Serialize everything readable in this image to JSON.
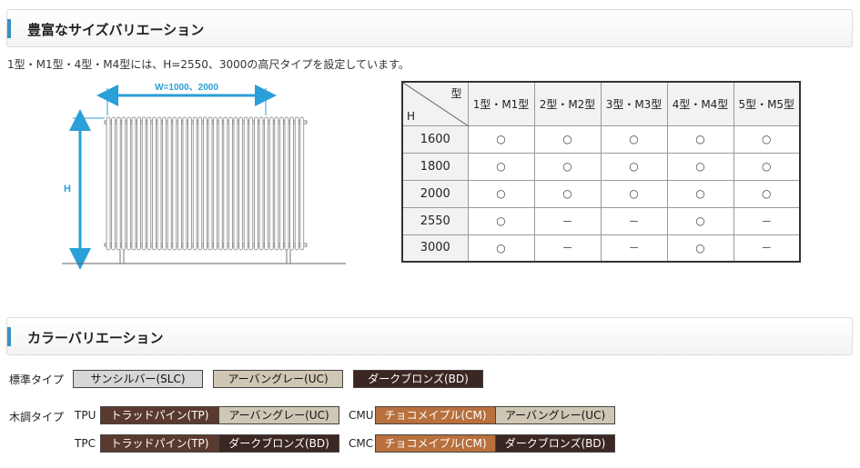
{
  "section1": {
    "title": "豊富なサイズバリエーション"
  },
  "description": "1型・M1型・4型・M4型には、H=2550、3000の高尺タイプを設定しています。",
  "diagram": {
    "width_label": "W=1000、2000",
    "height_label": "H"
  },
  "size_table": {
    "corner_top": "型",
    "corner_bottom": "H",
    "columns": [
      "1型・M1型",
      "2型・M2型",
      "3型・M3型",
      "4型・M4型",
      "5型・M5型"
    ],
    "rows": [
      {
        "h": "1600",
        "values": [
          "○",
          "○",
          "○",
          "○",
          "○"
        ]
      },
      {
        "h": "1800",
        "values": [
          "○",
          "○",
          "○",
          "○",
          "○"
        ]
      },
      {
        "h": "2000",
        "values": [
          "○",
          "○",
          "○",
          "○",
          "○"
        ]
      },
      {
        "h": "2550",
        "values": [
          "○",
          "－",
          "－",
          "○",
          "－"
        ]
      },
      {
        "h": "3000",
        "values": [
          "○",
          "－",
          "－",
          "○",
          "－"
        ]
      }
    ]
  },
  "section2": {
    "title": "カラーバリエーション"
  },
  "colors": {
    "standard_label": "標準タイプ",
    "standard": [
      "サンシルバー(SLC)",
      "アーバングレー(UC)",
      "ダークブロンズ(BD)"
    ],
    "wood_label": "木調タイプ",
    "tpu": {
      "code": "TPU",
      "left": "トラッドパイン(TP)",
      "right": "アーバングレー(UC)"
    },
    "cmu": {
      "code": "CMU",
      "left": "チョコメイプル(CM)",
      "right": "アーバングレー(UC)"
    },
    "tpc": {
      "code": "TPC",
      "left": "トラッドパイン(TP)",
      "right": "ダークブロンズ(BD)"
    },
    "cmc": {
      "code": "CMC",
      "left": "チョコメイプル(CM)",
      "right": "ダークブロンズ(BD)"
    }
  },
  "swatch_colors": {
    "SLC": "#d7d7d7",
    "UC": "#cfc6b4",
    "BD": "#3b2722",
    "TP": "#5a3a2e",
    "CM": "#b8703c"
  }
}
